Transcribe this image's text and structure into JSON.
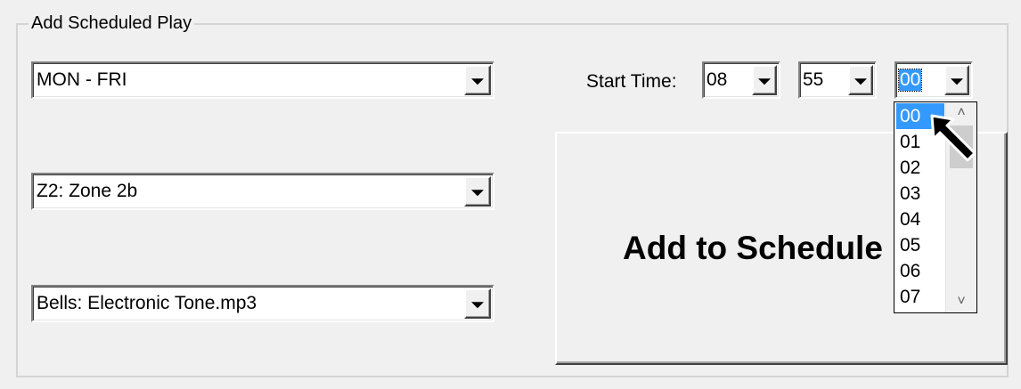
{
  "group": {
    "title": "Add Scheduled Play"
  },
  "day_select": {
    "value": "MON - FRI"
  },
  "zone_select": {
    "value": "Z2: Zone 2b"
  },
  "audio_select": {
    "value": "Bells: Electronic Tone.mp3"
  },
  "start_time": {
    "label": "Start Time:",
    "hour": "08",
    "minute": "55",
    "second": "00"
  },
  "seconds_list": {
    "items": [
      "00",
      "01",
      "02",
      "03",
      "04",
      "05",
      "06",
      "07"
    ],
    "selected": "00"
  },
  "add_button": {
    "label": "Add to Schedule"
  },
  "colors": {
    "selection": "#3399ff",
    "background": "#f0f0f0"
  }
}
